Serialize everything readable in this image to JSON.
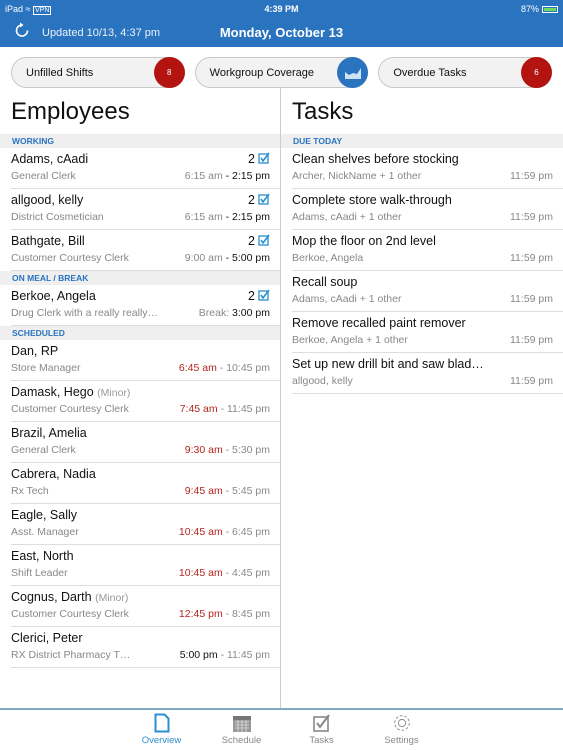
{
  "status_bar": {
    "device": "iPad",
    "vpn": "VPN",
    "time": "4:39 PM",
    "battery": "87%",
    "battery_level": 0.87
  },
  "header": {
    "updated": "Updated 10/13, 4:37 pm",
    "date": "Monday, October 13",
    "accent": "#2a73bf"
  },
  "pills": [
    {
      "label": "Unfilled Shifts",
      "badge": "8",
      "badge_color": "#b3140f"
    },
    {
      "label": "Workgroup Coverage",
      "icon": "area-chart-icon",
      "badge_color": "#2a73bf"
    },
    {
      "label": "Overdue Tasks",
      "badge": "6",
      "badge_color": "#b3140f"
    }
  ],
  "employees": {
    "title": "Employees",
    "sections": [
      {
        "header": "WORKING",
        "rows": [
          {
            "name": "Adams, cAadi",
            "count": "2",
            "role": "General Clerk",
            "start": "6:15 am",
            "sep": " - ",
            "end": "2:15 pm",
            "type": "working"
          },
          {
            "name": "allgood, kelly",
            "count": "2",
            "role": "District Cosmetician",
            "start": "6:15 am",
            "sep": " - ",
            "end": "2:15 pm",
            "type": "working"
          },
          {
            "name": "Bathgate, Bill",
            "count": "2",
            "role": "Customer Courtesy Clerk",
            "start": "9:00 am",
            "sep": " - ",
            "end": "5:00 pm",
            "type": "working"
          }
        ]
      },
      {
        "header": "ON MEAL / BREAK",
        "rows": [
          {
            "name": "Berkoe, Angela",
            "count": "2",
            "role": "Drug Clerk with a really really…",
            "start": "Break:",
            "sep": " ",
            "end": "3:00 pm",
            "type": "working"
          }
        ]
      },
      {
        "header": "SCHEDULED",
        "rows": [
          {
            "name": "Dan, RP",
            "role": "Store Manager",
            "start": "6:45 am",
            "sep": " - ",
            "end": "10:45 pm",
            "type": "scheduled",
            "start_color": "#b3261e"
          },
          {
            "name": "Damask, Hego",
            "minor": "(Minor)",
            "role": "Customer Courtesy Clerk",
            "start": "7:45 am",
            "sep": " - ",
            "end": "11:45 pm",
            "type": "scheduled",
            "start_color": "#b3261e"
          },
          {
            "name": "Brazil, Amelia",
            "role": "General Clerk",
            "start": "9:30 am",
            "sep": " - ",
            "end": "5:30 pm",
            "type": "scheduled",
            "start_color": "#b3261e"
          },
          {
            "name": "Cabrera, Nadia",
            "role": "Rx Tech",
            "start": "9:45 am",
            "sep": " - ",
            "end": "5:45 pm",
            "type": "scheduled",
            "start_color": "#b3261e"
          },
          {
            "name": "Eagle, Sally",
            "role": "Asst. Manager",
            "start": "10:45 am",
            "sep": " - ",
            "end": "6:45 pm",
            "type": "scheduled",
            "start_color": "#b3261e"
          },
          {
            "name": "East, North",
            "role": "Shift Leader",
            "start": "10:45 am",
            "sep": " - ",
            "end": "4:45 pm",
            "type": "scheduled",
            "start_color": "#b3261e"
          },
          {
            "name": "Cognus, Darth",
            "minor": "(Minor)",
            "role": "Customer Courtesy Clerk",
            "start": "12:45 pm",
            "sep": " - ",
            "end": "8:45 pm",
            "type": "scheduled",
            "start_color": "#b3261e"
          },
          {
            "name": "Clerici, Peter",
            "role": "RX District Pharmacy T…",
            "start": "5:00 pm",
            "sep": " - ",
            "end": "11:45 pm",
            "type": "scheduled",
            "start_color": "#111111"
          }
        ]
      }
    ]
  },
  "tasks": {
    "title": "Tasks",
    "sections": [
      {
        "header": "DUE TODAY",
        "rows": [
          {
            "title": "Clean shelves before stocking",
            "assignee": "Archer, NickName + 1 other",
            "due": "11:59 pm"
          },
          {
            "title": "Complete store walk-through",
            "assignee": "Adams, cAadi + 1 other",
            "due": "11:59 pm"
          },
          {
            "title": "Mop the floor on 2nd level",
            "assignee": "Berkoe, Angela",
            "due": "11:59 pm"
          },
          {
            "title": "Recall soup",
            "assignee": "Adams, cAadi + 1 other",
            "due": "11:59 pm"
          },
          {
            "title": "Remove recalled paint remover",
            "assignee": "Berkoe, Angela + 1 other",
            "due": "11:59 pm"
          },
          {
            "title": "Set up new drill bit and saw blad…",
            "assignee": "allgood, kelly",
            "due": "11:59 pm"
          }
        ]
      }
    ]
  },
  "tabbar": {
    "active": "Overview",
    "items": [
      {
        "label": "Overview",
        "icon": "document-icon"
      },
      {
        "label": "Schedule",
        "icon": "calendar-icon"
      },
      {
        "label": "Tasks",
        "icon": "checkbox-icon"
      },
      {
        "label": "Settings",
        "icon": "gear-icon"
      }
    ]
  }
}
